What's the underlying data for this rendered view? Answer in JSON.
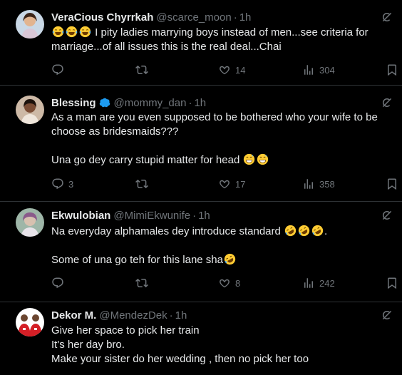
{
  "tweets": [
    {
      "name": "VeraCious Chyrrkah",
      "verified": false,
      "handle": "@scarce_moon",
      "time": "1h",
      "lines": [
        " I pity ladies marrying boys instead of men...see criteria for",
        "marriage...of all issues this is the real deal...Chai"
      ],
      "lead_emoji": [
        "laugh-cry",
        "laugh-cry",
        "laugh-cry"
      ],
      "replies": "",
      "retweets": "",
      "likes": "14",
      "views": "304"
    },
    {
      "name": "Blessing",
      "verified": true,
      "handle": "@mommy_dan",
      "time": "1h",
      "lines": [
        "As a man are you even supposed to be bothered who your wife to be",
        "choose as bridesmaids???"
      ],
      "line2": "Una go dey carry stupid matter for head",
      "replies": "3",
      "retweets": "",
      "likes": "17",
      "views": "358"
    },
    {
      "name": "Ekwulobian",
      "verified": false,
      "handle": "@MimiEkwunife",
      "time": "1h",
      "line1": "Na everyday alphamales dey introduce standard ",
      "line2": "Some of una go teh for this lane sha",
      "replies": "",
      "retweets": "",
      "likes": "8",
      "views": "242"
    },
    {
      "name": "Dekor M.",
      "verified": false,
      "handle": "@MendezDek",
      "time": "1h",
      "lines": [
        "Give her space to pick her train",
        "It's her day bro.",
        "Make your sister do her wedding , then no pick her too"
      ]
    }
  ],
  "separator": "·",
  "colors": {
    "background": "#000000",
    "text": "#e7e9ea",
    "muted": "#71767b",
    "verified": "#1d9bf0",
    "divider": "#2f3336"
  },
  "icons": [
    "reply-icon",
    "retweet-icon",
    "like-icon",
    "views-icon",
    "bookmark-icon",
    "grok-icon",
    "verified-badge-icon"
  ]
}
